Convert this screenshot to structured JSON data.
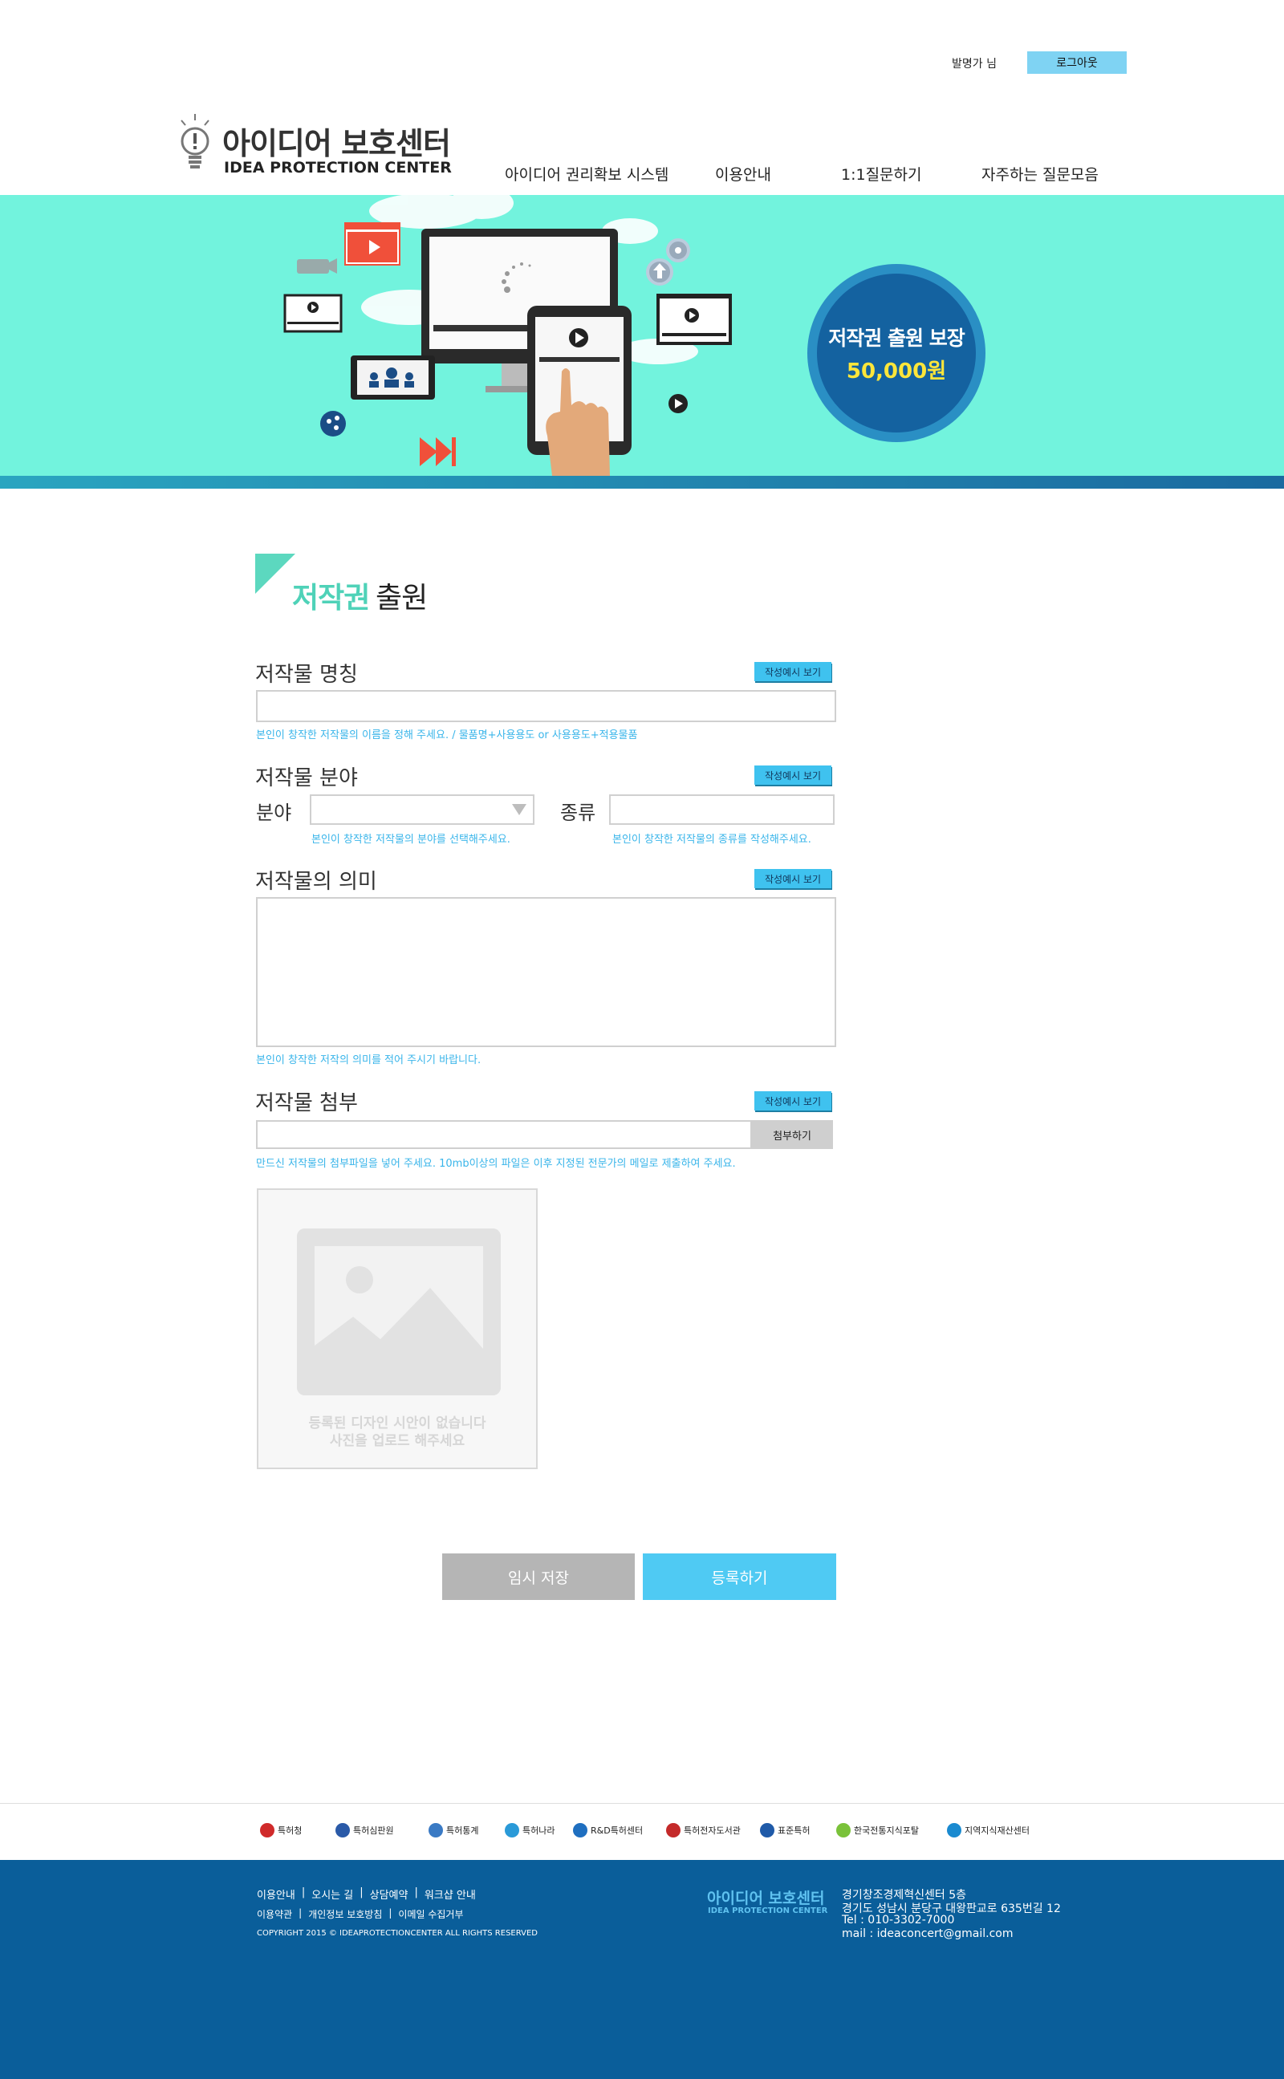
{
  "top_bar": {
    "user_name": "발명가 님",
    "logout_label": "로그아웃"
  },
  "logo": {
    "title": "아이디어 보호센터",
    "subtitle": "IDEA PROTECTION CENTER"
  },
  "nav": {
    "items": [
      {
        "label": "아이디어 권리확보 시스템"
      },
      {
        "label": "이용안내"
      },
      {
        "label": "1:1질문하기"
      },
      {
        "label": "자주하는 질문모음"
      }
    ]
  },
  "banner": {
    "promo_line1": "저작권 출원 보장",
    "promo_line2": "50,000원"
  },
  "page_title": {
    "part1": "저작권",
    "part2": "출원"
  },
  "form": {
    "example_label": "작성예시 보기",
    "work_name": {
      "label": "저작물 명칭",
      "value": "",
      "hint": "본인이 창작한 저작물의 이름을 정해 주세요. / 물품명+사용용도 or 사용용도+적용물품"
    },
    "work_field": {
      "label": "저작물 분야",
      "field_label": "분야",
      "field_value": "",
      "field_hint": "본인이 창작한 저작물의 분야를 선택해주세요.",
      "type_label": "종류",
      "type_value": "",
      "type_hint": "본인이 창작한 저작물의 종류를 작성해주세요."
    },
    "work_meaning": {
      "label": "저작물의 의미",
      "value": "",
      "hint": "본인이 창작한 저작의 의미를 적어 주시기 바랍니다."
    },
    "attachment": {
      "label": "저작물 첨부",
      "value": "",
      "attach_label": "첨부하기",
      "hint": "만드신 저작물의 첨부파일을 넣어 주세요. 10mb이상의 파일은 이후 지정된 전문가의 메일로 제출하여 주세요."
    },
    "preview": {
      "line1": "등록된 디자인 시안이 없습니다",
      "line2": "사진을 업로드 해주세요"
    },
    "temp_save_label": "임시 저장",
    "register_label": "등록하기"
  },
  "partners": [
    {
      "label": "특허청",
      "color": "#d02a2a"
    },
    {
      "label": "특허심판원",
      "color": "#2a5aa8"
    },
    {
      "label": "특허통계",
      "color": "#3a7ac4"
    },
    {
      "label": "특허나라",
      "color": "#2a9ad8"
    },
    {
      "label": "R&D특허센터",
      "color": "#1f6fc0"
    },
    {
      "label": "특허전자도서관",
      "color": "#c42a2a"
    },
    {
      "label": "표준특허",
      "color": "#1f5aa8"
    },
    {
      "label": "한국전통지식포탈",
      "color": "#7ac23a"
    },
    {
      "label": "지역지식재산센터",
      "color": "#1a8ad0"
    }
  ],
  "footer": {
    "links_row1": [
      "이용안내",
      "오시는 길",
      "상담예약",
      "워크샵 안내"
    ],
    "links_row2": [
      "이용약관",
      "개인정보 보호방침",
      "이메일 수집거부"
    ],
    "copyright": "COPYRIGHT 2015 © IDEAPROTECTIONCENTER ALL RIGHTS RESERVED",
    "logo_title": "아이디어 보호센터",
    "logo_sub": "IDEA PROTECTION CENTER",
    "address": [
      "경기창조경제혁신센터 5층",
      "경기도 성남시 분당구 대왕판교로 635번길 12",
      "Tel : 010-3302-7000",
      "mail : ideaconcert@gmail.com"
    ]
  },
  "colors": {
    "accent_mint": "#72f3dd",
    "accent_blue": "#3fc2ef",
    "footer_blue": "#0a5e9a",
    "promo_yellow": "#ffe63a"
  }
}
